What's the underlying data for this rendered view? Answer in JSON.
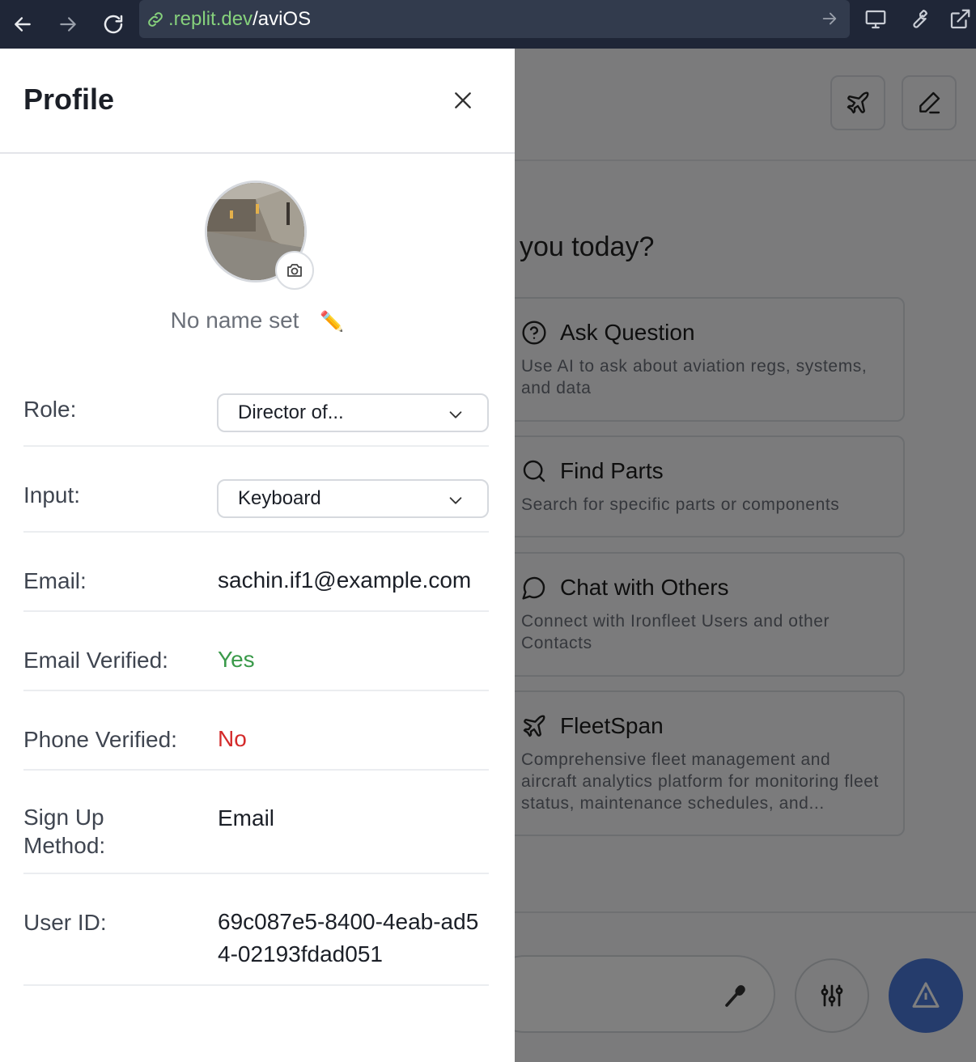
{
  "browser": {
    "url_host": ".replit.dev",
    "url_path": "/aviOS"
  },
  "app": {
    "greeting": "you today?",
    "cards": [
      {
        "icon": "question-circle-icon",
        "title": "Ask Question",
        "desc": "Use AI to ask about aviation regs, systems, and data"
      },
      {
        "icon": "search-icon",
        "title": "Find Parts",
        "desc": "Search for specific parts or components"
      },
      {
        "icon": "chat-bubble-icon",
        "title": "Chat with Others",
        "desc": "Connect with Ironfleet Users and other Contacts"
      },
      {
        "icon": "airplane-icon",
        "title": "FleetSpan",
        "desc": "Comprehensive fleet management and aircraft analytics platform for monitoring fleet status, maintenance schedules, and..."
      }
    ],
    "colors": {
      "send_button": "#4a79d8"
    }
  },
  "profile": {
    "title": "Profile",
    "name": "No name set",
    "edit_icon": "✏️",
    "role_label": "Role:",
    "role_value": "Director of...",
    "input_label": "Input:",
    "input_value": "Keyboard",
    "email_label": "Email:",
    "email_value": "sachin.if1@example.com",
    "email_verified_label": "Email Verified:",
    "email_verified_value": "Yes",
    "phone_verified_label": "Phone Verified:",
    "phone_verified_value": "No",
    "signup_label": "Sign Up Method:",
    "signup_value": "Email",
    "userid_label": "User ID:",
    "userid_value": "69c087e5-8400-4eab-ad54-02193fdad051",
    "colors": {
      "yes": "#3a9a4a",
      "no": "#d42a2a"
    }
  }
}
